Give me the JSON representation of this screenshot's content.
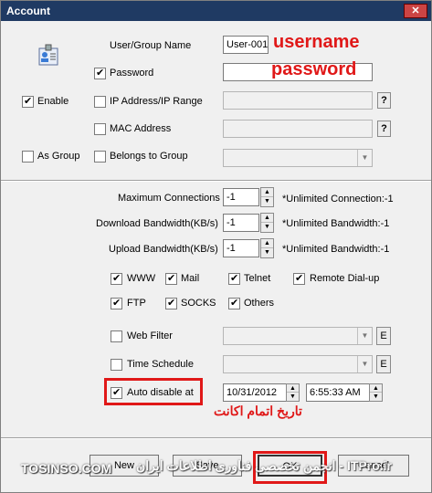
{
  "window": {
    "title": "Account",
    "close_label": "✕"
  },
  "fields": {
    "user_group_name_label": "User/Group Name",
    "user_group_name_value": "User-001",
    "password_label": "Password",
    "password_value": "",
    "enable_label": "Enable",
    "ip_label": "IP Address/IP Range",
    "mac_label": "MAC Address",
    "as_group_label": "As Group",
    "belongs_label": "Belongs to Group",
    "help_label": "?"
  },
  "limits": {
    "max_connections_label": "Maximum Connections",
    "max_connections_value": "-1",
    "max_connections_hint": "*Unlimited Connection:-1",
    "download_label": "Download Bandwidth(KB/s)",
    "download_value": "-1",
    "download_hint": "*Unlimited Bandwidth:-1",
    "upload_label": "Upload Bandwidth(KB/s)",
    "upload_value": "-1",
    "upload_hint": "*Unlimited Bandwidth:-1"
  },
  "services": {
    "www": "WWW",
    "mail": "Mail",
    "telnet": "Telnet",
    "dialup": "Remote Dial-up",
    "ftp": "FTP",
    "socks": "SOCKS",
    "others": "Others"
  },
  "filters": {
    "web_filter_label": "Web Filter",
    "time_schedule_label": "Time Schedule",
    "auto_disable_label": "Auto disable at",
    "date_value": "10/31/2012",
    "time_value": "6:55:33 AM",
    "e_label": "E"
  },
  "buttons": {
    "new": "New",
    "save": "Save",
    "ok": "OK",
    "cancel": "Cancel"
  },
  "annotations": {
    "username": "username",
    "password": "password",
    "expiry": "تاریخ اتمام اکانت"
  },
  "watermarks": {
    "left": "TOSINSO.COM",
    "right": "ITPro.ir - انجمن تخصصی فناوری اطلاعات ایران"
  },
  "colors": {
    "annotation_red": "#e01818",
    "titlebar": "#1f3a63"
  }
}
